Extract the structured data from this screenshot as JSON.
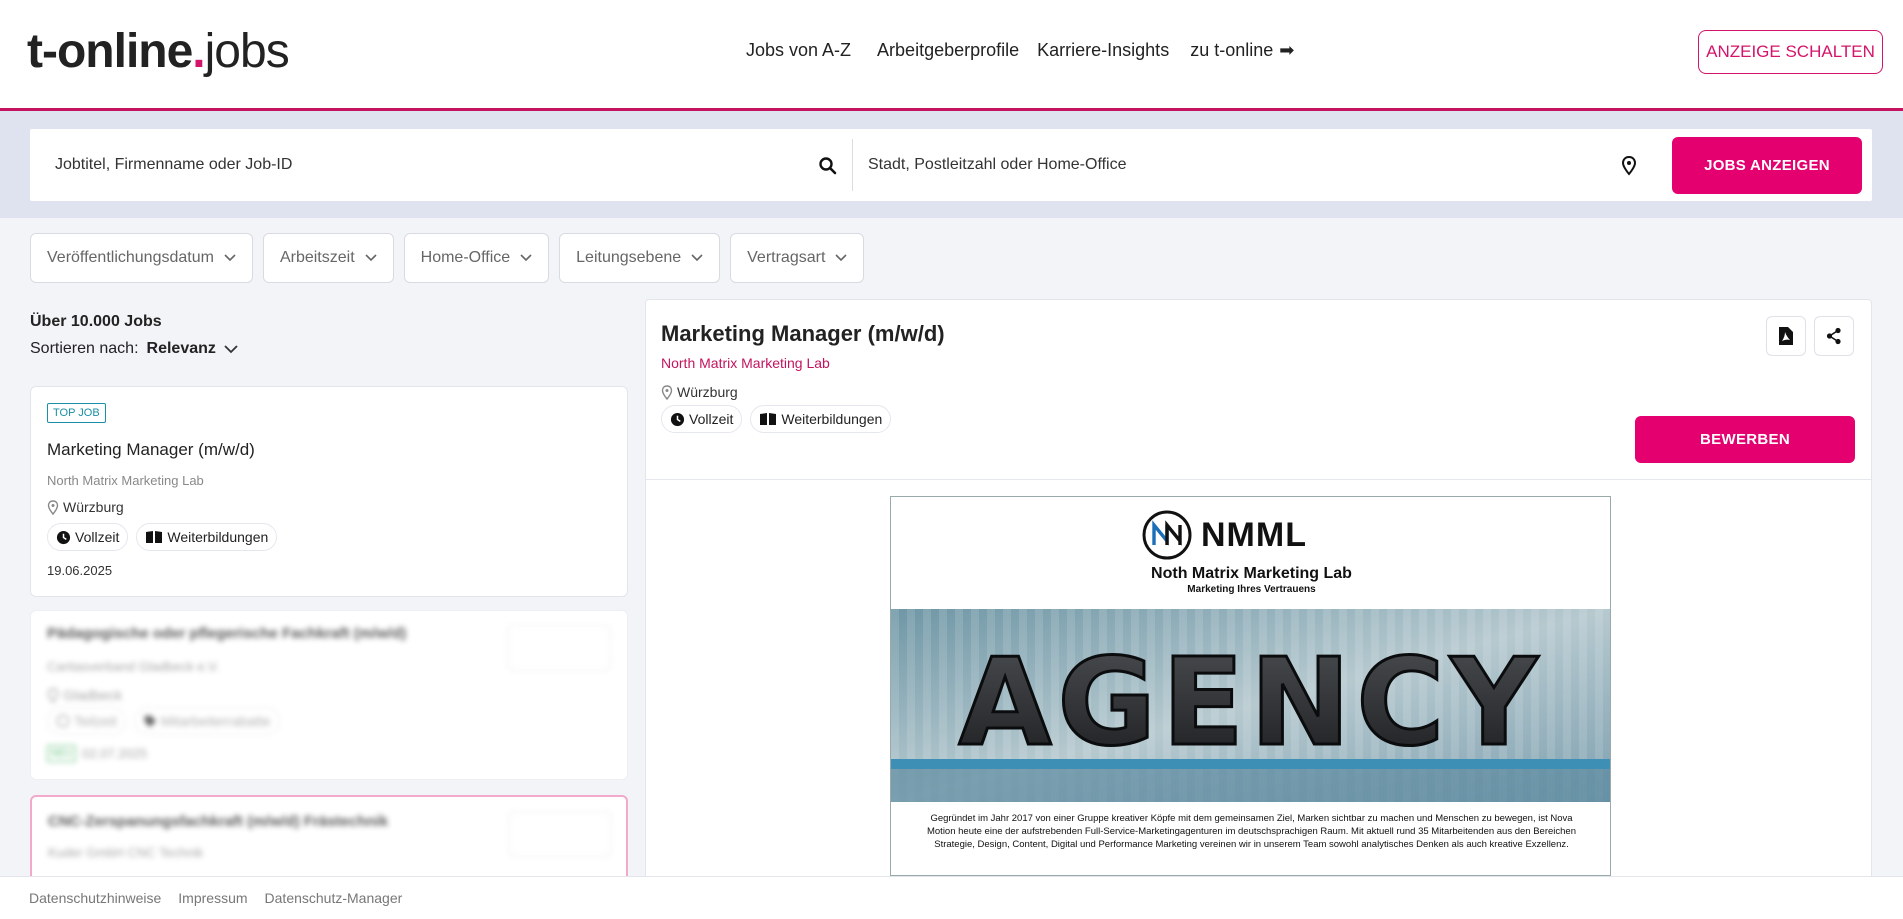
{
  "header": {
    "logo_brand": "t-online",
    "logo_dot": ".",
    "logo_jobs": "jobs",
    "nav": [
      "Jobs von A-Z",
      "Arbeitgeberprofile",
      "Karriere-Insights",
      "zu t-online"
    ],
    "nav_arrow": "➡",
    "cta": "ANZEIGE SCHALTEN"
  },
  "search": {
    "what_placeholder": "Jobtitel, Firmenname oder Job-ID",
    "where_placeholder": "Stadt, Postleitzahl oder Home-Office",
    "button": "JOBS  ANZEIGEN"
  },
  "filters": [
    "Veröffentlichungsdatum",
    "Arbeitszeit",
    "Home-Office",
    "Leitungsebene",
    "Vertragsart"
  ],
  "results": {
    "count_prefix": "Über",
    "count_value": "10.000",
    "count_suffix": "Jobs",
    "sort_label": "Sortieren nach:",
    "sort_value": "Relevanz"
  },
  "job_list": [
    {
      "badge": "TOP JOB",
      "title": "Marketing Manager (m/w/d)",
      "company": "North Matrix Marketing Lab",
      "location": "Würzburg",
      "tags": [
        "Vollzeit",
        "Weiterbildungen"
      ],
      "date": "19.06.2025"
    },
    {
      "title": "Pädagogische oder pflegerische Fachkraft (m/w/d)",
      "company": "Caritasverband Gladbeck e.V.",
      "location": "Gladbeck",
      "tags": [
        "Teilzeit",
        "Mitarbeiterrabatte"
      ],
      "badge_new": "NEU",
      "date": "02.07.2025"
    },
    {
      "title": "CNC-Zerspanungsfachkraft (m/w/d) Frästechnik",
      "company": "Kuder GmbH CNC Technik"
    }
  ],
  "detail": {
    "title": "Marketing Manager (m/w/d)",
    "company": "North Matrix Marketing Lab",
    "location": "Würzburg",
    "tags": [
      "Vollzeit",
      "Weiterbildungen"
    ],
    "apply": "BEWERBEN",
    "ad": {
      "logo_text": "NMML",
      "company_name": "Noth Matrix Marketing Lab",
      "slogan": "Marketing Ihres Vertrauens",
      "image_word": "AGENCY",
      "description": "Gegründet im Jahr 2017 von einer Gruppe kreativer Köpfe mit dem gemeinsamen Ziel, Marken sichtbar zu machen und Menschen zu bewegen, ist Nova Motion heute eine der aufstrebenden Full-Service-Marketingagenturen im deutschsprachigen Raum. Mit aktuell rund 35 Mitarbeitenden aus den Bereichen Strategie, Design, Content, Digital und Performance Marketing vereinen wir in unserem Team sowohl analytisches Denken als auch kreative Exzellenz."
    }
  },
  "footer": [
    "Datenschutzhinweise",
    "Impressum",
    "Datenschutz-Manager"
  ],
  "colors": {
    "brand": "#e4006f",
    "accent_line": "#c4145f",
    "top_job": "#1a8fa6",
    "new": "#27a84a"
  }
}
